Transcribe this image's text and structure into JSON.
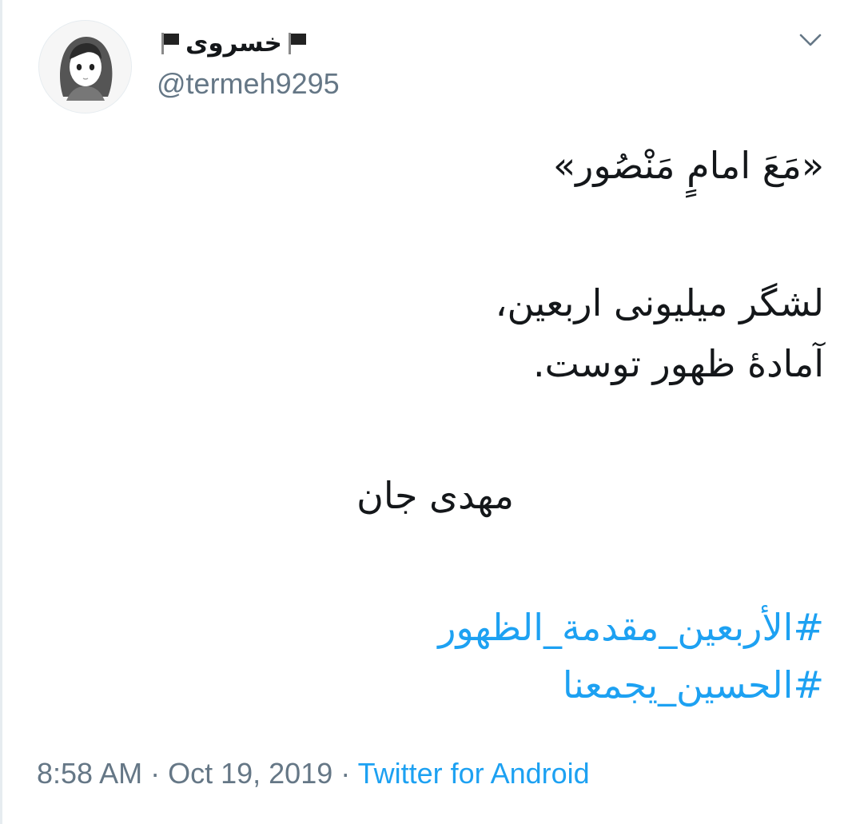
{
  "user": {
    "display_name": "خسروی",
    "handle": "@termeh9295",
    "flag_icon": "black-flag-icon",
    "avatar_icon": "anime-girl-hijab-avatar"
  },
  "menu": {
    "icon": "chevron-down-icon"
  },
  "tweet": {
    "line1": "«مَعَ امامٍ مَنْصُور»",
    "line2": "لشگر میلیونی اربعین،",
    "line3": "آمادهٔ ظهور توست.",
    "line4": "مهدی جان",
    "hashtags": [
      "#الأربعین_مقدمة_الظهور",
      "#الحسین_یجمعنا"
    ]
  },
  "meta": {
    "time": "8:58 AM",
    "sep1": " · ",
    "date": "Oct 19, 2019",
    "sep2": " · ",
    "source": "Twitter for Android"
  },
  "colors": {
    "accent": "#1da1f2",
    "text": "#14171a",
    "secondary": "#657786"
  }
}
